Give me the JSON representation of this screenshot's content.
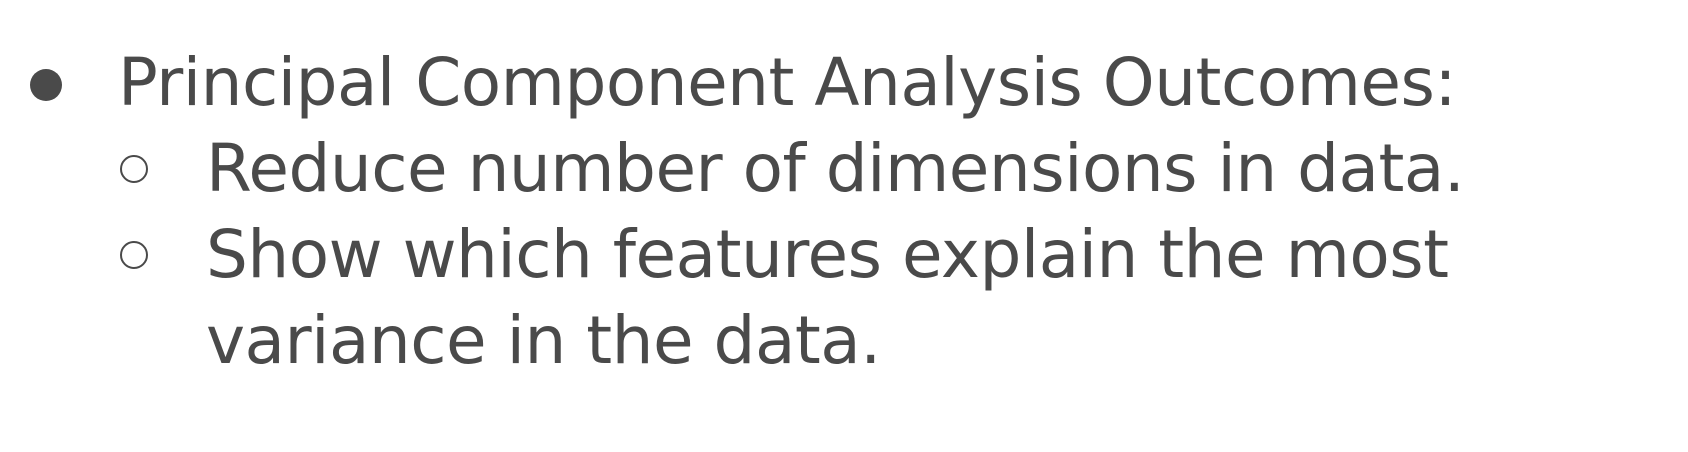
{
  "slide": {
    "bullets": [
      {
        "text": "Principal Component Analysis Outcomes:",
        "children": [
          {
            "text": "Reduce number of dimensions in data."
          },
          {
            "text": "Show which features explain the most variance in the data."
          }
        ]
      }
    ]
  },
  "colors": {
    "text": "#4a4a4a",
    "background": "#ffffff"
  }
}
